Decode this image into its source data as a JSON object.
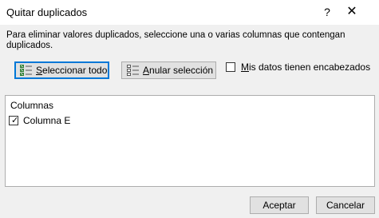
{
  "window": {
    "title": "Quitar duplicados",
    "help_label": "?",
    "close_label": "✕"
  },
  "description": "Para eliminar valores duplicados, seleccione una o varias columnas que contengan duplicados.",
  "buttons": {
    "select_all_accel": "S",
    "select_all_rest": "eleccionar todo",
    "unselect_all_accel": "A",
    "unselect_all_rest": "nular selección",
    "accept": "Aceptar",
    "cancel": "Cancelar"
  },
  "headers_checkbox": {
    "accel": "M",
    "rest": "is datos tienen encabezados",
    "checked": false
  },
  "columns_list": {
    "header": "Columnas",
    "items": [
      {
        "label": "Columna E",
        "checked": true
      }
    ]
  },
  "colors": {
    "focus_border": "#0078d7",
    "button_bg": "#e1e1e1",
    "dialog_bg": "#f0f0f0"
  }
}
